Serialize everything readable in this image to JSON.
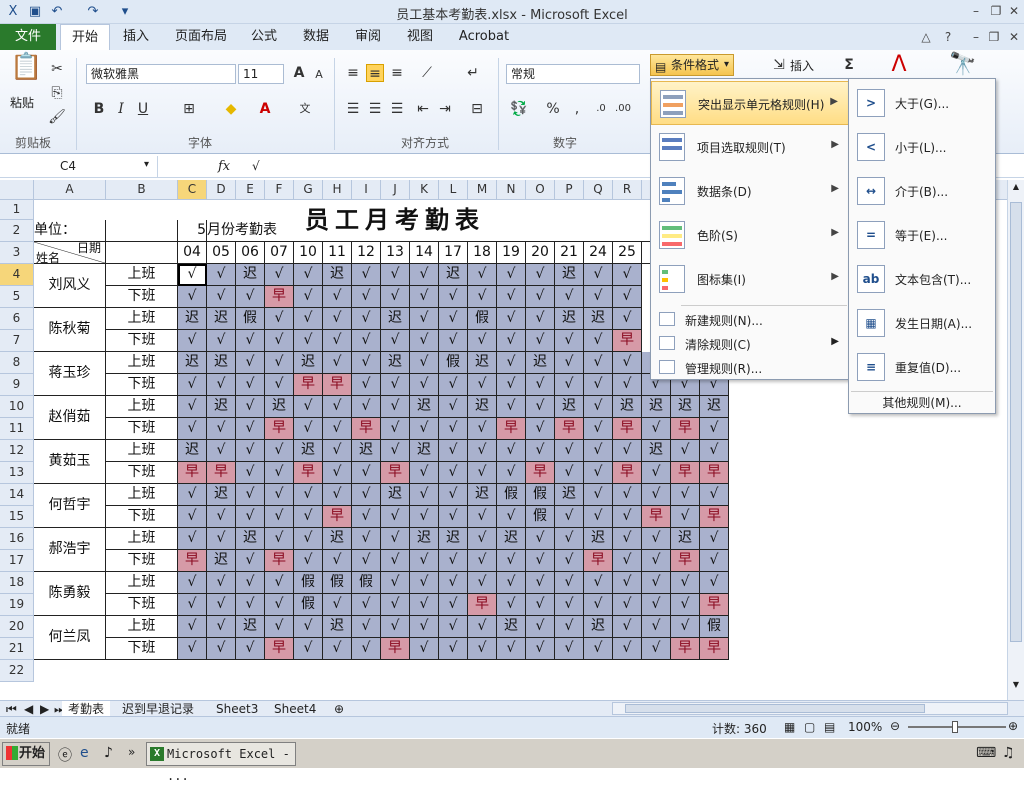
{
  "window": {
    "title": "员工基本考勤表.xlsx - Microsoft Excel"
  },
  "ribbon_tabs": {
    "file": "文件",
    "tabs": [
      "开始",
      "插入",
      "页面布局",
      "公式",
      "数据",
      "审阅",
      "视图",
      "Acrobat"
    ],
    "active": 0
  },
  "ribbon": {
    "paste_label": "粘贴",
    "clipboard_label": "剪贴板",
    "font_name": "微软雅黑",
    "font_size": "11",
    "font_label": "字体",
    "align_label": "对齐方式",
    "number_format": "常规",
    "number_label": "数字",
    "cond_format": "条件格式",
    "insert": "插入",
    "sigma": "Σ"
  },
  "formula_bar": {
    "name_box": "C4",
    "fx": "fx",
    "value": "√"
  },
  "sheet": {
    "title": "员工月考勤表",
    "unit_label": "单位：",
    "month_num": "5",
    "month_label": "月份考勤表",
    "date_label": "日期",
    "name_label": "姓名",
    "columns": [
      "A",
      "B",
      "C",
      "D",
      "E",
      "F",
      "G",
      "H",
      "I",
      "J",
      "K",
      "L",
      "M",
      "N",
      "O",
      "P",
      "Q",
      "R"
    ],
    "rows": [
      "1",
      "2",
      "3",
      "4",
      "5",
      "6",
      "7",
      "8",
      "9",
      "10",
      "11",
      "12",
      "13",
      "14",
      "15",
      "16",
      "17",
      "18",
      "19",
      "20",
      "21",
      "22"
    ],
    "dates": [
      "04",
      "05",
      "06",
      "07",
      "10",
      "11",
      "12",
      "13",
      "14",
      "17",
      "18",
      "19",
      "20",
      "21",
      "24",
      "25"
    ],
    "employees": [
      {
        "name": "刘风义",
        "shifts": [
          "上班",
          "下班"
        ]
      },
      {
        "name": "陈秋菊",
        "shifts": [
          "上班",
          "下班"
        ]
      },
      {
        "name": "蒋玉珍",
        "shifts": [
          "上班",
          "下班"
        ]
      },
      {
        "name": "赵俏茹",
        "shifts": [
          "上班",
          "下班"
        ]
      },
      {
        "name": "黄茹玉",
        "shifts": [
          "上班",
          "下班"
        ]
      },
      {
        "name": "何哲宇",
        "shifts": [
          "上班",
          "下班"
        ]
      },
      {
        "name": "郝浩宇",
        "shifts": [
          "上班",
          "下班"
        ]
      },
      {
        "name": "陈勇毅",
        "shifts": [
          "上班",
          "下班"
        ]
      },
      {
        "name": "何兰凤",
        "shifts": [
          "上班",
          "下班"
        ]
      }
    ],
    "grid": [
      [
        "√",
        "√",
        "迟",
        "√",
        "√",
        "迟",
        "√",
        "√",
        "√",
        "迟",
        "√",
        "√",
        "√",
        "迟",
        "√",
        "√",
        "",
        "",
        ""
      ],
      [
        "√",
        "√",
        "√",
        "早",
        "√",
        "√",
        "√",
        "√",
        "√",
        "√",
        "√",
        "√",
        "√",
        "√",
        "√",
        "√",
        "",
        "",
        ""
      ],
      [
        "迟",
        "迟",
        "假",
        "√",
        "√",
        "√",
        "√",
        "迟",
        "√",
        "√",
        "假",
        "√",
        "√",
        "迟",
        "迟",
        "√",
        "",
        "",
        ""
      ],
      [
        "√",
        "√",
        "√",
        "√",
        "√",
        "√",
        "√",
        "√",
        "√",
        "√",
        "√",
        "√",
        "√",
        "√",
        "√",
        "早",
        "",
        "",
        ""
      ],
      [
        "迟",
        "迟",
        "√",
        "√",
        "迟",
        "√",
        "√",
        "迟",
        "√",
        "假",
        "迟",
        "√",
        "迟",
        "√",
        "√",
        "√",
        "√",
        "迟",
        "迟"
      ],
      [
        "√",
        "√",
        "√",
        "√",
        "早",
        "早",
        "√",
        "√",
        "√",
        "√",
        "√",
        "√",
        "√",
        "√",
        "√",
        "√",
        "√",
        "√",
        "√"
      ],
      [
        "√",
        "迟",
        "√",
        "迟",
        "√",
        "√",
        "√",
        "√",
        "迟",
        "√",
        "迟",
        "√",
        "√",
        "迟",
        "√",
        "迟",
        "迟",
        "迟",
        "迟"
      ],
      [
        "√",
        "√",
        "√",
        "早",
        "√",
        "√",
        "早",
        "√",
        "√",
        "√",
        "√",
        "早",
        "√",
        "早",
        "√",
        "早",
        "√",
        "早",
        "√"
      ],
      [
        "迟",
        "√",
        "√",
        "√",
        "迟",
        "√",
        "迟",
        "√",
        "迟",
        "√",
        "√",
        "√",
        "√",
        "√",
        "√",
        "√",
        "迟",
        "√",
        "√"
      ],
      [
        "早",
        "早",
        "√",
        "√",
        "早",
        "√",
        "√",
        "早",
        "√",
        "√",
        "√",
        "√",
        "早",
        "√",
        "√",
        "早",
        "√",
        "早",
        "早"
      ],
      [
        "√",
        "迟",
        "√",
        "√",
        "√",
        "√",
        "√",
        "迟",
        "√",
        "√",
        "迟",
        "假",
        "假",
        "迟",
        "√",
        "√",
        "√",
        "√",
        "√"
      ],
      [
        "√",
        "√",
        "√",
        "√",
        "√",
        "早",
        "√",
        "√",
        "√",
        "√",
        "√",
        "√",
        "假",
        "√",
        "√",
        "√",
        "早",
        "√",
        "早"
      ],
      [
        "√",
        "√",
        "迟",
        "√",
        "√",
        "迟",
        "√",
        "√",
        "迟",
        "迟",
        "√",
        "迟",
        "√",
        "√",
        "迟",
        "√",
        "√",
        "迟",
        "√"
      ],
      [
        "早",
        "迟",
        "√",
        "早",
        "√",
        "√",
        "√",
        "√",
        "√",
        "√",
        "√",
        "√",
        "√",
        "√",
        "早",
        "√",
        "√",
        "早",
        "√"
      ],
      [
        "√",
        "√",
        "√",
        "√",
        "假",
        "假",
        "假",
        "√",
        "√",
        "√",
        "√",
        "√",
        "√",
        "√",
        "√",
        "√",
        "√",
        "√",
        "√"
      ],
      [
        "√",
        "√",
        "√",
        "√",
        "假",
        "√",
        "√",
        "√",
        "√",
        "√",
        "早",
        "√",
        "√",
        "√",
        "√",
        "√",
        "√",
        "√",
        "早"
      ],
      [
        "√",
        "√",
        "迟",
        "√",
        "√",
        "迟",
        "√",
        "√",
        "√",
        "√",
        "√",
        "迟",
        "√",
        "√",
        "迟",
        "√",
        "√",
        "√",
        "假"
      ],
      [
        "√",
        "√",
        "√",
        "早",
        "√",
        "√",
        "√",
        "早",
        "√",
        "√",
        "√",
        "√",
        "√",
        "√",
        "√",
        "√",
        "√",
        "早",
        "早"
      ]
    ]
  },
  "cf_menu": {
    "items": [
      "突出显示单元格规则(H)",
      "项目选取规则(T)",
      "数据条(D)",
      "色阶(S)",
      "图标集(I)"
    ],
    "links": [
      "新建规则(N)...",
      "清除规则(C)",
      "管理规则(R)..."
    ]
  },
  "sub_menu": {
    "items": [
      "大于(G)...",
      "小于(L)...",
      "介于(B)...",
      "等于(E)...",
      "文本包含(T)...",
      "发生日期(A)...",
      "重复值(D)..."
    ],
    "more": "其他规则(M)..."
  },
  "sheet_tabs": [
    "考勤表",
    "迟到早退记录",
    "Sheet3",
    "Sheet4"
  ],
  "status": {
    "ready": "就绪",
    "count": "计数: 360",
    "zoom": "100%"
  },
  "taskbar": {
    "start": "开始",
    "item": "Microsoft Excel - ..."
  }
}
